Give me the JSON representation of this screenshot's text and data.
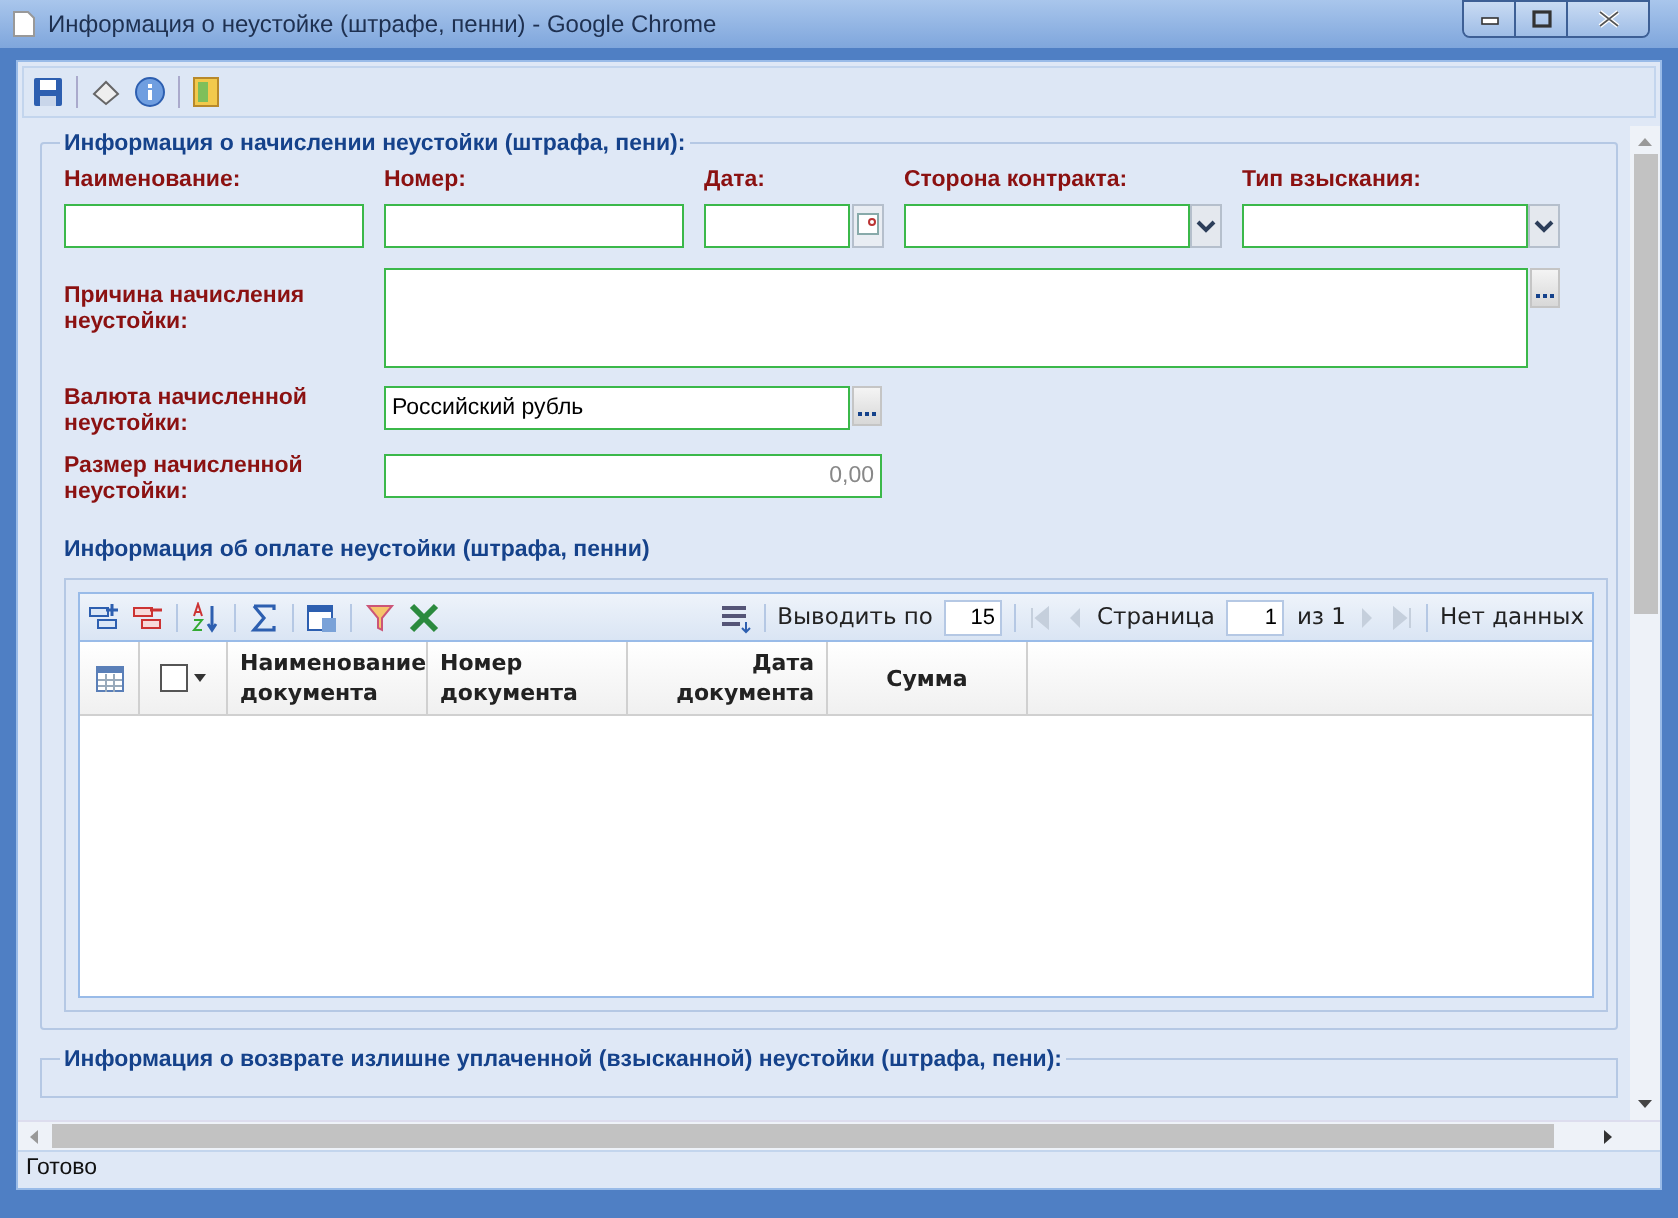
{
  "window": {
    "title": "Информация о неустойке (штрафе, пенни) - Google Chrome"
  },
  "accrual": {
    "title": "Информация о начислении неустойки (штрафа, пени):",
    "row_1": [
      {
        "label": "Наименование:",
        "kind": "text"
      },
      {
        "label": "Номер:",
        "kind": "text"
      },
      {
        "label": "Дата:",
        "kind": "date"
      },
      {
        "label": "Сторона контракта:",
        "kind": "combo"
      },
      {
        "label": "Тип взыскания:",
        "kind": "combo"
      }
    ],
    "reason": {
      "label": "Причина начисления неустойки:"
    },
    "currency": {
      "label": "Валюта начисленной неустойки:",
      "value": "Российский рубль"
    },
    "amount": {
      "label": "Размер начисленной неустойки:",
      "value": "0,00"
    }
  },
  "payments": {
    "title": "Информация об оплате неустойки (штрафа, пенни)",
    "pager": {
      "page_size_label": "Выводить по",
      "page_size": "15",
      "page_label": "Страница",
      "page": "1",
      "page_count": "из 1",
      "status": "Нет данных"
    },
    "select_all": {
      "checked": false
    },
    "columns": [
      {
        "label": "Наименование документа"
      },
      {
        "label": "Номер документа"
      },
      {
        "label": "Дата документа"
      },
      {
        "label": "Сумма"
      }
    ]
  },
  "refund": {
    "title": "Информация о возврате излишне уплаченной (взысканной) неустойки (штрафа, пени):"
  },
  "status_bar": "Готово"
}
